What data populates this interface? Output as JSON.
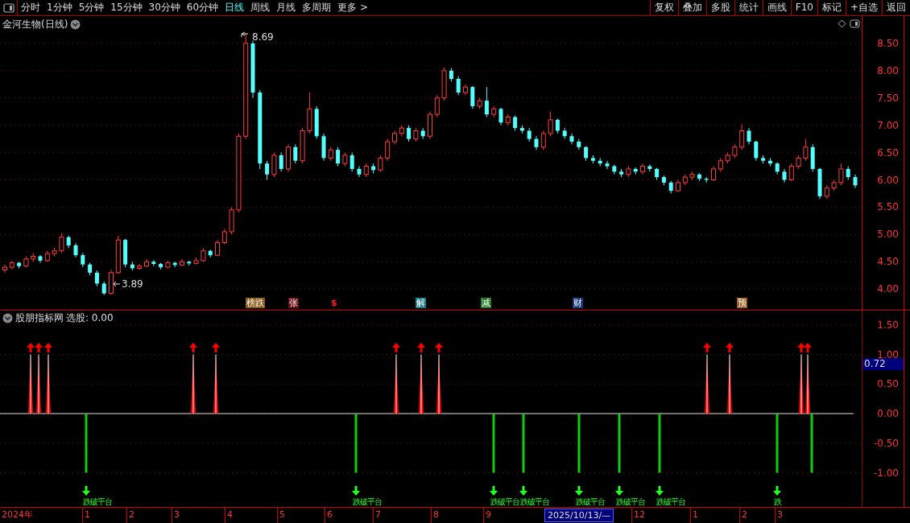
{
  "toolbar": {
    "periods": [
      {
        "label": "分时",
        "selected": false
      },
      {
        "label": "1分钟",
        "selected": false
      },
      {
        "label": "5分钟",
        "selected": false
      },
      {
        "label": "15分钟",
        "selected": false
      },
      {
        "label": "30分钟",
        "selected": false
      },
      {
        "label": "60分钟",
        "selected": false
      },
      {
        "label": "日线",
        "selected": true
      },
      {
        "label": "周线",
        "selected": false
      },
      {
        "label": "月线",
        "selected": false
      },
      {
        "label": "多周期",
        "selected": false
      },
      {
        "label": "更多 >",
        "selected": false
      }
    ],
    "buttons": [
      "复权",
      "叠加",
      "多股",
      "统计",
      "画线",
      "F10",
      "标记",
      "+自选",
      "返回"
    ]
  },
  "main_chart": {
    "title": "金河生物(日线)",
    "high_label": "8.69",
    "low_label": "3.89",
    "chart_data": {
      "type": "candlestick",
      "grid": true,
      "ylim": [
        3.62,
        9.0
      ],
      "yticks": [
        {
          "value": 8.5,
          "label": "8.50"
        },
        {
          "value": 8.0,
          "label": "8.00"
        },
        {
          "value": 7.5,
          "label": "7.50"
        },
        {
          "value": 7.0,
          "label": "7.00"
        },
        {
          "value": 6.5,
          "label": "6.50"
        },
        {
          "value": 6.0,
          "label": "6.00"
        },
        {
          "value": 5.5,
          "label": "5.50"
        },
        {
          "value": 5.0,
          "label": "5.00"
        },
        {
          "value": 4.5,
          "label": "4.50"
        },
        {
          "value": 4.0,
          "label": "4.00"
        }
      ],
      "ohlc": [
        [
          4.35,
          4.45,
          4.3,
          4.4
        ],
        [
          4.4,
          4.52,
          4.36,
          4.48
        ],
        [
          4.48,
          4.5,
          4.38,
          4.42
        ],
        [
          4.42,
          4.6,
          4.4,
          4.55
        ],
        [
          4.55,
          4.66,
          4.5,
          4.6
        ],
        [
          4.6,
          4.62,
          4.48,
          4.52
        ],
        [
          4.52,
          4.7,
          4.5,
          4.65
        ],
        [
          4.65,
          4.76,
          4.6,
          4.7
        ],
        [
          4.7,
          5.02,
          4.66,
          4.95
        ],
        [
          4.95,
          4.98,
          4.75,
          4.8
        ],
        [
          4.8,
          4.84,
          4.58,
          4.62
        ],
        [
          4.62,
          4.66,
          4.4,
          4.45
        ],
        [
          4.45,
          4.48,
          4.25,
          4.3
        ],
        [
          4.3,
          4.34,
          4.05,
          4.1
        ],
        [
          4.1,
          4.14,
          3.89,
          3.92
        ],
        [
          3.92,
          4.36,
          3.9,
          4.3
        ],
        [
          4.3,
          4.98,
          4.28,
          4.9
        ],
        [
          4.9,
          4.92,
          4.4,
          4.45
        ],
        [
          4.45,
          4.5,
          4.34,
          4.38
        ],
        [
          4.38,
          4.46,
          4.35,
          4.42
        ],
        [
          4.42,
          4.55,
          4.4,
          4.5
        ],
        [
          4.5,
          4.53,
          4.42,
          4.46
        ],
        [
          4.46,
          4.48,
          4.36,
          4.4
        ],
        [
          4.4,
          4.52,
          4.38,
          4.48
        ],
        [
          4.48,
          4.5,
          4.4,
          4.44
        ],
        [
          4.44,
          4.55,
          4.42,
          4.5
        ],
        [
          4.5,
          4.52,
          4.43,
          4.47
        ],
        [
          4.47,
          4.58,
          4.45,
          4.52
        ],
        [
          4.52,
          4.75,
          4.5,
          4.7
        ],
        [
          4.7,
          4.72,
          4.58,
          4.62
        ],
        [
          4.62,
          4.9,
          4.6,
          4.85
        ],
        [
          4.85,
          5.1,
          4.82,
          5.05
        ],
        [
          5.05,
          5.5,
          5.0,
          5.45
        ],
        [
          5.45,
          6.85,
          5.4,
          6.8
        ],
        [
          6.8,
          8.69,
          6.75,
          8.5
        ],
        [
          8.5,
          8.55,
          7.5,
          7.6
        ],
        [
          7.6,
          7.65,
          6.2,
          6.3
        ],
        [
          6.3,
          6.35,
          6.0,
          6.1
        ],
        [
          6.1,
          6.5,
          6.05,
          6.45
        ],
        [
          6.45,
          6.5,
          6.15,
          6.2
        ],
        [
          6.2,
          6.65,
          6.15,
          6.6
        ],
        [
          6.6,
          6.65,
          6.3,
          6.35
        ],
        [
          6.35,
          6.95,
          6.3,
          6.9
        ],
        [
          6.9,
          7.6,
          6.85,
          7.3
        ],
        [
          7.3,
          7.35,
          6.75,
          6.8
        ],
        [
          6.8,
          6.85,
          6.35,
          6.4
        ],
        [
          6.4,
          6.6,
          6.35,
          6.55
        ],
        [
          6.55,
          6.6,
          6.25,
          6.3
        ],
        [
          6.3,
          6.5,
          6.25,
          6.45
        ],
        [
          6.45,
          6.5,
          6.15,
          6.2
        ],
        [
          6.2,
          6.25,
          6.05,
          6.1
        ],
        [
          6.1,
          6.3,
          6.05,
          6.25
        ],
        [
          6.25,
          6.3,
          6.12,
          6.18
        ],
        [
          6.18,
          6.45,
          6.15,
          6.4
        ],
        [
          6.4,
          6.75,
          6.35,
          6.7
        ],
        [
          6.7,
          6.9,
          6.65,
          6.85
        ],
        [
          6.85,
          7.0,
          6.8,
          6.95
        ],
        [
          6.95,
          7.0,
          6.7,
          6.75
        ],
        [
          6.75,
          6.95,
          6.7,
          6.9
        ],
        [
          6.9,
          6.95,
          6.75,
          6.8
        ],
        [
          6.8,
          7.25,
          6.75,
          7.2
        ],
        [
          7.2,
          7.55,
          7.15,
          7.5
        ],
        [
          7.5,
          8.06,
          7.45,
          8.0
        ],
        [
          8.0,
          8.05,
          7.8,
          7.85
        ],
        [
          7.85,
          7.9,
          7.55,
          7.6
        ],
        [
          7.6,
          7.75,
          7.55,
          7.7
        ],
        [
          7.7,
          7.72,
          7.3,
          7.35
        ],
        [
          7.35,
          7.5,
          7.3,
          7.45
        ],
        [
          7.45,
          7.7,
          7.15,
          7.2
        ],
        [
          7.2,
          7.35,
          7.15,
          7.3
        ],
        [
          7.3,
          7.32,
          7.0,
          7.05
        ],
        [
          7.05,
          7.2,
          7.0,
          7.15
        ],
        [
          7.15,
          7.18,
          6.9,
          6.95
        ],
        [
          6.95,
          7.0,
          6.85,
          6.9
        ],
        [
          6.9,
          6.95,
          6.7,
          6.75
        ],
        [
          6.75,
          6.8,
          6.55,
          6.6
        ],
        [
          6.6,
          6.9,
          6.55,
          6.85
        ],
        [
          6.85,
          7.25,
          6.8,
          7.1
        ],
        [
          7.1,
          7.12,
          6.85,
          6.9
        ],
        [
          6.9,
          6.95,
          6.75,
          6.8
        ],
        [
          6.8,
          6.85,
          6.65,
          6.7
        ],
        [
          6.7,
          6.75,
          6.55,
          6.6
        ],
        [
          6.6,
          6.62,
          6.35,
          6.4
        ],
        [
          6.4,
          6.45,
          6.3,
          6.35
        ],
        [
          6.35,
          6.4,
          6.25,
          6.3
        ],
        [
          6.3,
          6.35,
          6.2,
          6.25
        ],
        [
          6.25,
          6.28,
          6.1,
          6.15
        ],
        [
          6.15,
          6.2,
          6.05,
          6.1
        ],
        [
          6.1,
          6.25,
          6.05,
          6.2
        ],
        [
          6.2,
          6.23,
          6.1,
          6.15
        ],
        [
          6.15,
          6.3,
          6.1,
          6.25
        ],
        [
          6.25,
          6.28,
          6.15,
          6.2
        ],
        [
          6.2,
          6.22,
          6.0,
          6.05
        ],
        [
          6.05,
          6.08,
          5.9,
          5.95
        ],
        [
          5.95,
          5.98,
          5.75,
          5.8
        ],
        [
          5.8,
          6.0,
          5.78,
          5.95
        ],
        [
          5.95,
          6.1,
          5.9,
          6.05
        ],
        [
          6.05,
          6.15,
          6.0,
          6.1
        ],
        [
          6.1,
          6.12,
          5.98,
          6.02
        ],
        [
          6.02,
          6.05,
          5.95,
          6.0
        ],
        [
          6.0,
          6.25,
          5.98,
          6.2
        ],
        [
          6.2,
          6.4,
          6.15,
          6.35
        ],
        [
          6.35,
          6.5,
          6.3,
          6.45
        ],
        [
          6.45,
          6.65,
          6.4,
          6.6
        ],
        [
          6.6,
          7.02,
          6.55,
          6.9
        ],
        [
          6.9,
          6.95,
          6.65,
          6.7
        ],
        [
          6.7,
          6.72,
          6.35,
          6.4
        ],
        [
          6.4,
          6.45,
          6.3,
          6.35
        ],
        [
          6.35,
          6.4,
          6.25,
          6.3
        ],
        [
          6.3,
          6.32,
          6.1,
          6.15
        ],
        [
          6.15,
          6.2,
          5.95,
          6.0
        ],
        [
          6.0,
          6.3,
          5.98,
          6.25
        ],
        [
          6.25,
          6.45,
          6.2,
          6.4
        ],
        [
          6.4,
          6.75,
          6.35,
          6.6
        ],
        [
          6.6,
          6.65,
          6.15,
          6.2
        ],
        [
          6.2,
          6.22,
          5.65,
          5.7
        ],
        [
          5.7,
          5.9,
          5.65,
          5.85
        ],
        [
          5.85,
          6.0,
          5.8,
          5.95
        ],
        [
          5.95,
          6.3,
          5.9,
          6.2
        ],
        [
          6.2,
          6.25,
          6.0,
          6.05
        ],
        [
          6.05,
          6.1,
          5.85,
          5.9
        ]
      ]
    },
    "event_tags": [
      {
        "label": "榜跌",
        "kind": "badge",
        "color": "#8a5a1a"
      },
      {
        "label": "张",
        "kind": "badge",
        "color": "#6a1010"
      },
      {
        "label": "$",
        "kind": "symbol",
        "color": "#ff2020"
      },
      {
        "label": "解",
        "kind": "badge",
        "color": "#1a7a8a"
      },
      {
        "label": "减",
        "kind": "badge",
        "color": "#2a7a2a"
      },
      {
        "label": "财",
        "kind": "badge",
        "color": "#1a3a7a"
      },
      {
        "label": "预",
        "kind": "badge",
        "color": "#9a5a20"
      }
    ]
  },
  "indicator": {
    "title": "股朋指标网",
    "stock_pick": "选股: 0.00",
    "ticks": [
      "1.50",
      "1.00",
      "0.50",
      "0.00",
      "-0.50",
      "-1.00"
    ],
    "current_value": "0.72",
    "signals": [
      "跌破平台",
      "跌破平台",
      "跌破平台",
      "跌破平台",
      "跌破平台",
      "跌破平台",
      "跌破平台",
      "跌"
    ]
  },
  "date_axis": {
    "labels": [
      "2024年",
      "1",
      "2",
      "3",
      "4",
      "5",
      "6",
      "7",
      "8",
      "9",
      "12",
      "1",
      "2",
      "3"
    ],
    "cursor_date": "2025/10/13/—"
  }
}
